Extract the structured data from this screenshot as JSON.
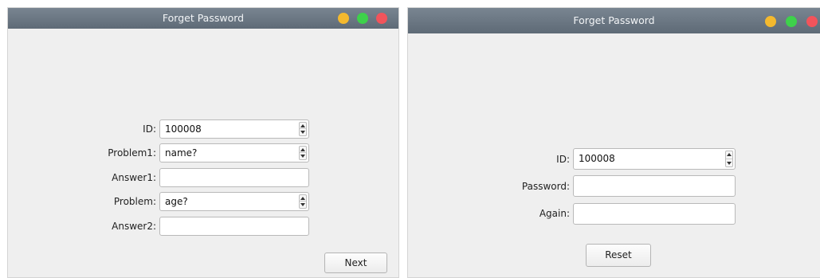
{
  "left_window": {
    "title": "Forget Password",
    "id_label": "ID:",
    "id_value": "100008",
    "problem1_label": "Problem1:",
    "problem1_value": "name?",
    "answer1_label": "Answer1:",
    "answer1_value": "",
    "problem2_label": "Problem:",
    "problem2_value": "age?",
    "answer2_label": "Answer2:",
    "answer2_value": "",
    "next_label": "Next"
  },
  "right_window": {
    "title": "Forget Password",
    "id_label": "ID:",
    "id_value": "100008",
    "password_label": "Password:",
    "password_value": "",
    "again_label": "Again:",
    "again_value": "",
    "reset_label": "Reset"
  },
  "colors": {
    "titlebar": "#6b7784",
    "window_bg": "#efefef",
    "minimize": "#f4b92e",
    "maximize": "#3ed14b",
    "close": "#f2545b"
  }
}
